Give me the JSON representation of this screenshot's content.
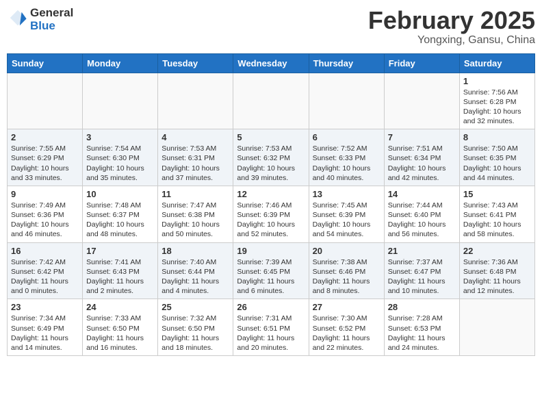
{
  "header": {
    "logo_line1": "General",
    "logo_line2": "Blue",
    "month": "February 2025",
    "location": "Yongxing, Gansu, China"
  },
  "weekdays": [
    "Sunday",
    "Monday",
    "Tuesday",
    "Wednesday",
    "Thursday",
    "Friday",
    "Saturday"
  ],
  "weeks": [
    [
      {
        "day": "",
        "info": ""
      },
      {
        "day": "",
        "info": ""
      },
      {
        "day": "",
        "info": ""
      },
      {
        "day": "",
        "info": ""
      },
      {
        "day": "",
        "info": ""
      },
      {
        "day": "",
        "info": ""
      },
      {
        "day": "1",
        "info": "Sunrise: 7:56 AM\nSunset: 6:28 PM\nDaylight: 10 hours and 32 minutes."
      }
    ],
    [
      {
        "day": "2",
        "info": "Sunrise: 7:55 AM\nSunset: 6:29 PM\nDaylight: 10 hours and 33 minutes."
      },
      {
        "day": "3",
        "info": "Sunrise: 7:54 AM\nSunset: 6:30 PM\nDaylight: 10 hours and 35 minutes."
      },
      {
        "day": "4",
        "info": "Sunrise: 7:53 AM\nSunset: 6:31 PM\nDaylight: 10 hours and 37 minutes."
      },
      {
        "day": "5",
        "info": "Sunrise: 7:53 AM\nSunset: 6:32 PM\nDaylight: 10 hours and 39 minutes."
      },
      {
        "day": "6",
        "info": "Sunrise: 7:52 AM\nSunset: 6:33 PM\nDaylight: 10 hours and 40 minutes."
      },
      {
        "day": "7",
        "info": "Sunrise: 7:51 AM\nSunset: 6:34 PM\nDaylight: 10 hours and 42 minutes."
      },
      {
        "day": "8",
        "info": "Sunrise: 7:50 AM\nSunset: 6:35 PM\nDaylight: 10 hours and 44 minutes."
      }
    ],
    [
      {
        "day": "9",
        "info": "Sunrise: 7:49 AM\nSunset: 6:36 PM\nDaylight: 10 hours and 46 minutes."
      },
      {
        "day": "10",
        "info": "Sunrise: 7:48 AM\nSunset: 6:37 PM\nDaylight: 10 hours and 48 minutes."
      },
      {
        "day": "11",
        "info": "Sunrise: 7:47 AM\nSunset: 6:38 PM\nDaylight: 10 hours and 50 minutes."
      },
      {
        "day": "12",
        "info": "Sunrise: 7:46 AM\nSunset: 6:39 PM\nDaylight: 10 hours and 52 minutes."
      },
      {
        "day": "13",
        "info": "Sunrise: 7:45 AM\nSunset: 6:39 PM\nDaylight: 10 hours and 54 minutes."
      },
      {
        "day": "14",
        "info": "Sunrise: 7:44 AM\nSunset: 6:40 PM\nDaylight: 10 hours and 56 minutes."
      },
      {
        "day": "15",
        "info": "Sunrise: 7:43 AM\nSunset: 6:41 PM\nDaylight: 10 hours and 58 minutes."
      }
    ],
    [
      {
        "day": "16",
        "info": "Sunrise: 7:42 AM\nSunset: 6:42 PM\nDaylight: 11 hours and 0 minutes."
      },
      {
        "day": "17",
        "info": "Sunrise: 7:41 AM\nSunset: 6:43 PM\nDaylight: 11 hours and 2 minutes."
      },
      {
        "day": "18",
        "info": "Sunrise: 7:40 AM\nSunset: 6:44 PM\nDaylight: 11 hours and 4 minutes."
      },
      {
        "day": "19",
        "info": "Sunrise: 7:39 AM\nSunset: 6:45 PM\nDaylight: 11 hours and 6 minutes."
      },
      {
        "day": "20",
        "info": "Sunrise: 7:38 AM\nSunset: 6:46 PM\nDaylight: 11 hours and 8 minutes."
      },
      {
        "day": "21",
        "info": "Sunrise: 7:37 AM\nSunset: 6:47 PM\nDaylight: 11 hours and 10 minutes."
      },
      {
        "day": "22",
        "info": "Sunrise: 7:36 AM\nSunset: 6:48 PM\nDaylight: 11 hours and 12 minutes."
      }
    ],
    [
      {
        "day": "23",
        "info": "Sunrise: 7:34 AM\nSunset: 6:49 PM\nDaylight: 11 hours and 14 minutes."
      },
      {
        "day": "24",
        "info": "Sunrise: 7:33 AM\nSunset: 6:50 PM\nDaylight: 11 hours and 16 minutes."
      },
      {
        "day": "25",
        "info": "Sunrise: 7:32 AM\nSunset: 6:50 PM\nDaylight: 11 hours and 18 minutes."
      },
      {
        "day": "26",
        "info": "Sunrise: 7:31 AM\nSunset: 6:51 PM\nDaylight: 11 hours and 20 minutes."
      },
      {
        "day": "27",
        "info": "Sunrise: 7:30 AM\nSunset: 6:52 PM\nDaylight: 11 hours and 22 minutes."
      },
      {
        "day": "28",
        "info": "Sunrise: 7:28 AM\nSunset: 6:53 PM\nDaylight: 11 hours and 24 minutes."
      },
      {
        "day": "",
        "info": ""
      }
    ]
  ]
}
